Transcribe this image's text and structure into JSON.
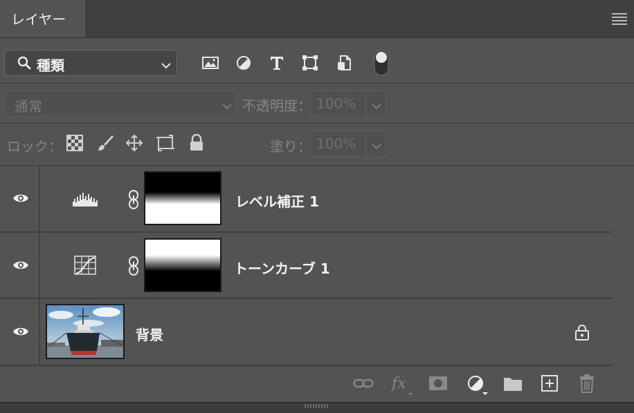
{
  "panel": {
    "tab_title": "レイヤー"
  },
  "filter": {
    "kind_label": "種類"
  },
  "blend": {
    "mode_label": "通常",
    "opacity_label": "不透明度：",
    "opacity_value": "100%"
  },
  "lock": {
    "label": "ロック：",
    "fill_label": "塗り：",
    "fill_value": "100%"
  },
  "layers": [
    {
      "name": "レベル補正 1",
      "type": "adjustment-levels"
    },
    {
      "name": "トーンカーブ 1",
      "type": "adjustment-curves"
    },
    {
      "name": "背景",
      "type": "background-photo",
      "locked": true
    }
  ],
  "colors": {
    "panel_bg": "#535353",
    "tab_bg": "#404040",
    "text": "#f2f2f2",
    "dim_text": "#858585"
  }
}
